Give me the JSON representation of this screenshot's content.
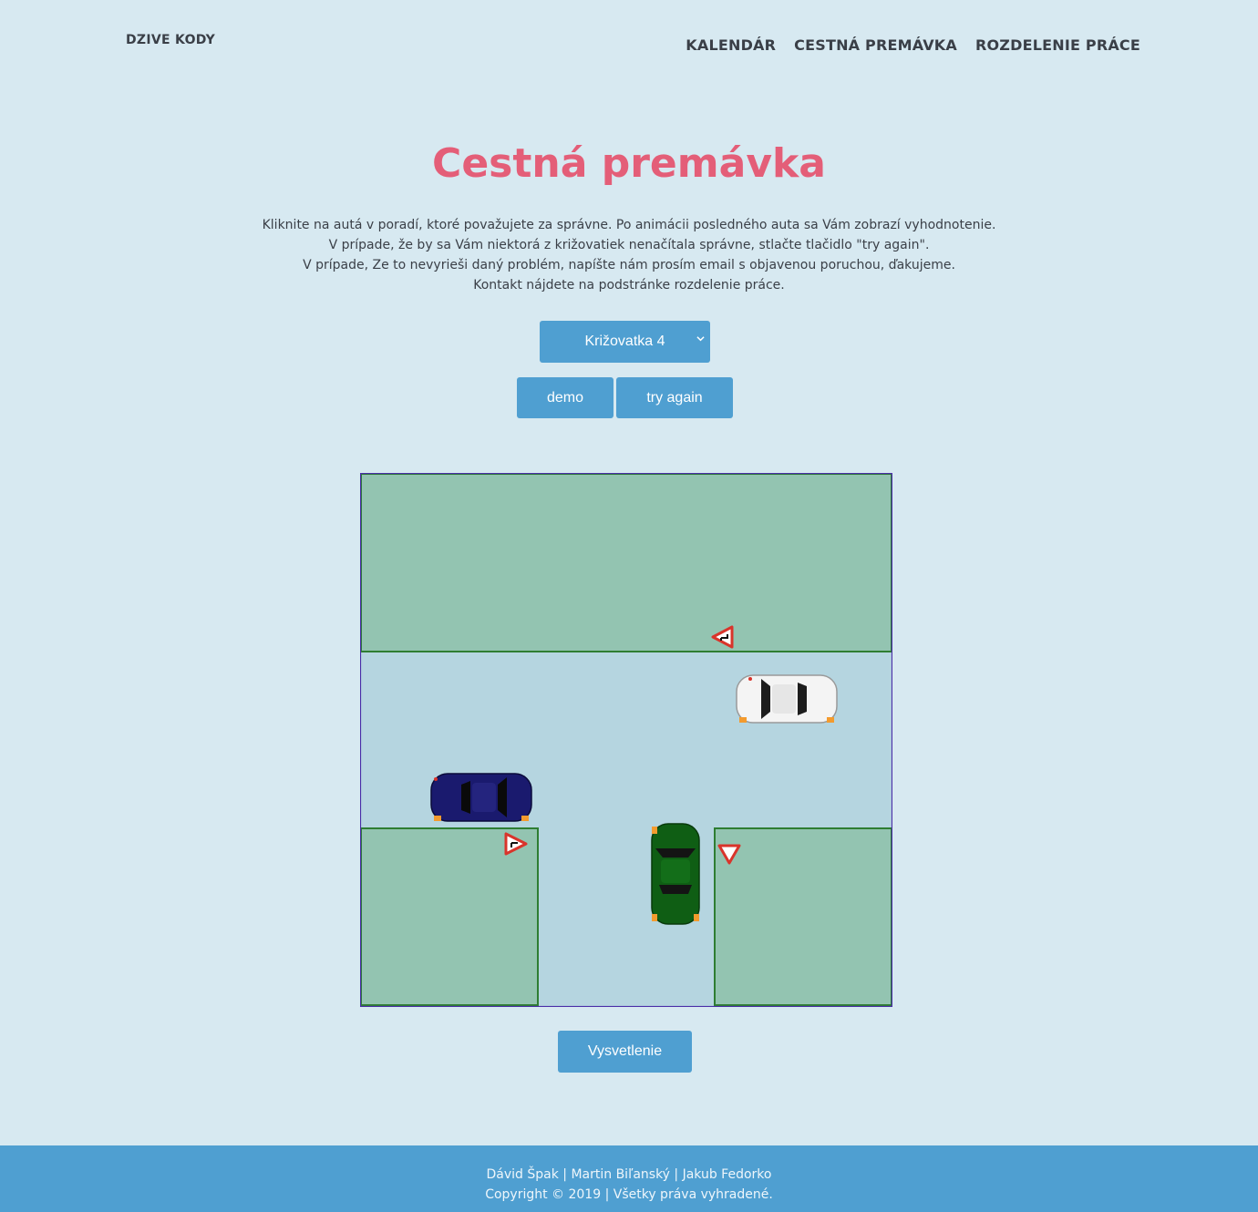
{
  "header": {
    "brand": "DZIVE KODY",
    "nav": [
      {
        "label": "KALENDÁR"
      },
      {
        "label": "CESTNÁ PREMÁVKA"
      },
      {
        "label": "ROZDELENIE PRÁCE"
      }
    ]
  },
  "main": {
    "title": "Cestná premávka",
    "instructions": [
      "Kliknite na autá v poradí, ktoré považujete za správne. Po animácii posledného auta sa Vám zobrazí vyhodnotenie.",
      "V prípade, že by sa Vám niektorá z križovatiek nenačítala správne, stlačte tlačidlo \"try again\".",
      "V prípade, Ze to nevyrieši daný problém, napíšte nám prosím email s objavenou poruchou, ďakujeme.",
      "Kontakt nájdete na podstránke rozdelenie práce."
    ],
    "intersection_select": {
      "selected": "Križovatka 4"
    },
    "buttons": {
      "demo": "demo",
      "try_again": "try again",
      "explanation": "Vysvetlenie"
    }
  },
  "scene": {
    "colors": {
      "grass": "#93c4b1",
      "road": "#b5d5e0",
      "border": "#2e7d32",
      "frame": "#4a2fa8",
      "sign_red": "#d9342b"
    },
    "cars": [
      {
        "name": "white-car",
        "color": "#ffffff"
      },
      {
        "name": "blue-car",
        "color": "#1a1a6e"
      },
      {
        "name": "green-car",
        "color": "#0f5e14"
      }
    ],
    "signs": [
      {
        "name": "priority-road-shape-sign-top"
      },
      {
        "name": "priority-road-shape-sign-left"
      },
      {
        "name": "yield-sign"
      }
    ]
  },
  "footer": {
    "authors": "Dávid Špak | Martin Biľanský | Jakub Fedorko",
    "copyright": "Copyright © 2019 | Všetky práva vyhradené."
  }
}
